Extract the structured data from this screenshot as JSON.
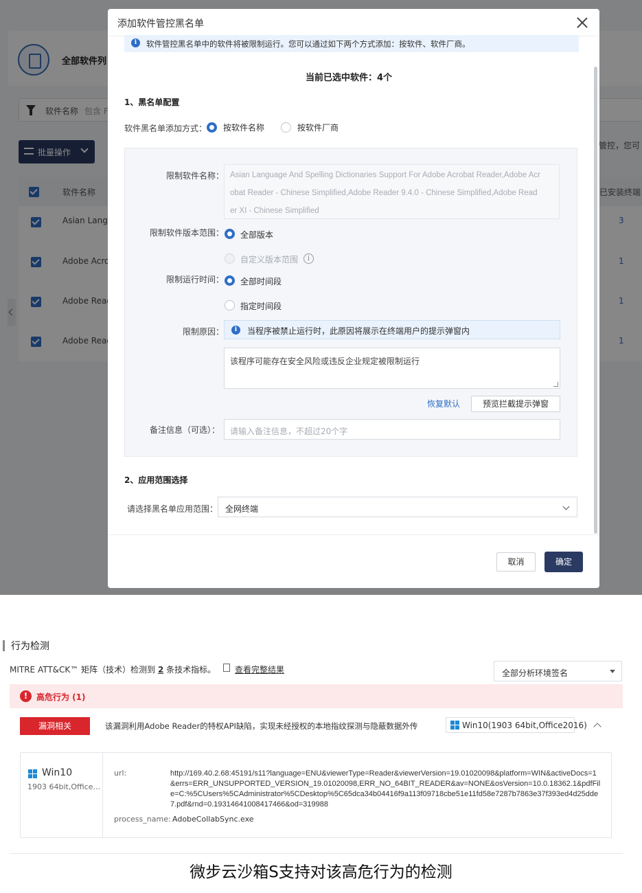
{
  "background_app": {
    "page_title": "全部软件列",
    "filter_label": "软件名称",
    "filter_op": "包含 F",
    "batch_button": "批量操作",
    "right_note": "管控，您可",
    "col_name": "软件名称",
    "col_installed": "已安装终端",
    "rows": [
      {
        "name": "Asian Langu",
        "count": "3"
      },
      {
        "name": "Adobe Acrob",
        "count": "1"
      },
      {
        "name": "Adobe Read",
        "count": "1"
      },
      {
        "name": "Adobe Read",
        "count": "1"
      }
    ]
  },
  "modal": {
    "title": "添加软件管控黑名单",
    "info_text": "软件管控黑名单中的软件将被限制运行。您可以通过如下两个方式添加：按软件、软件厂商。",
    "selected_text": "当前已选中软件：4个",
    "section1": "1、黑名单配置",
    "add_method_label": "软件黑名单添加方式：",
    "add_method_options": [
      "按软件名称",
      "按软件厂商"
    ],
    "restrict_name_label": "限制软件名称：",
    "restrict_name_lines": [
      "Asian Language And Spelling Dictionaries Support For Adobe Acrobat Reader,Adobe Acr",
      "obat Reader - Chinese Simplified,Adobe Reader 9.4.0 - Chinese Simplified,Adobe Read",
      "er XI - Chinese Simplified"
    ],
    "version_label": "限制软件版本范围：",
    "version_options": [
      "全部版本",
      "自定义版本范围"
    ],
    "time_label": "限制运行时间：",
    "time_options": [
      "全部时间段",
      "指定时间段"
    ],
    "reason_label": "限制原因：",
    "reason_info": "当程序被禁止运行时，此原因将展示在终端用户的提示弹窗内",
    "reason_text": "该程序可能存在安全风险或违反企业规定被限制运行",
    "restore_default": "恢复默认",
    "preview_button": "预览拦截提示弹窗",
    "remark_label": "备注信息（可选）：",
    "remark_placeholder": "请输入备注信息，不超过20个字",
    "section2": "2、应用范围选择",
    "scope_label": "请选择黑名单应用范围：",
    "scope_value": "全网终端",
    "cancel": "取消",
    "confirm": "确定"
  },
  "behavior": {
    "title": "行为检测",
    "mitre_prefix": "MITRE ATT&CK™ 矩阵（技术）检测到",
    "mitre_count": "2",
    "mitre_suffix": "条技术指标。",
    "full_results": "查看完整结果",
    "dropdown": "全部分析环境签名",
    "high_risk": "高危行为 (1)",
    "tag": "漏洞相关",
    "description": "该漏洞利用Adobe Reader的特权API缺陷，实现未经授权的本地指纹探测与隐蔽数据外传",
    "os_tag": "Win10(1903 64bit,Office2016)",
    "env_name": "Win10",
    "env_sub": "1903 64bit,Office...",
    "url_label": "url:",
    "url_value": "http://169.40.2.68:45191/s11?language=ENU&viewerType=Reader&viewerVersion=19.01020098&platform=WIN&activeDocs=1&errs=ERR_UNSUPPORTED_VERSION_19.01020098,ERR_NO_64BIT_READER&av=NONE&osVersion=10.0.18362.1&pdfFile=C:%5CUsers%5CAdministrator%5CDesktop%5C65dca34b04416f9a113f09718cbe51e11fd58e7287b7863e37f393ed4d25dde7.pdf&rnd=0.19314641008417466&od=319988",
    "process_label": "process_name:",
    "process_value": "AdobeCollabSync.exe"
  },
  "caption": "微步云沙箱S支持对该高危行为的检测",
  "colors": {
    "primary": "#2b3a63",
    "accent_blue": "#2f6ec6",
    "danger": "#d9252c",
    "alert_bg": "#fde9ea"
  }
}
